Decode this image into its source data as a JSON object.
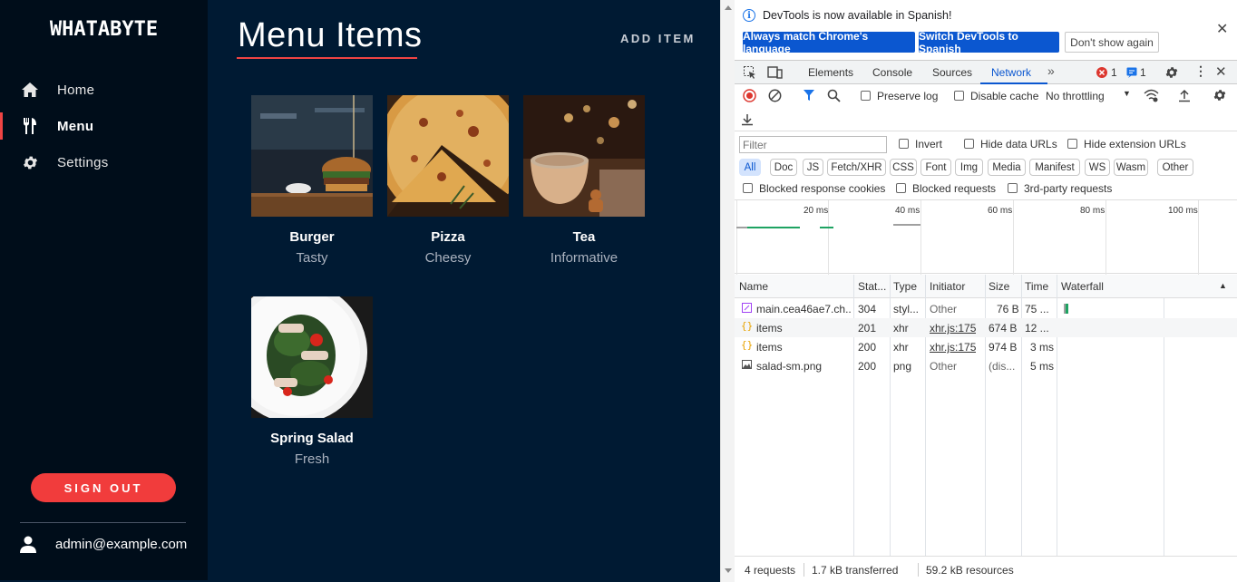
{
  "app": {
    "brand": "WHATABYTE",
    "nav": [
      {
        "label": "Home",
        "icon": "home-icon"
      },
      {
        "label": "Menu",
        "icon": "utensils-icon"
      },
      {
        "label": "Settings",
        "icon": "gear-icon"
      }
    ],
    "active_nav": "Menu",
    "sign_out": "SIGN OUT",
    "user_email": "admin@example.com",
    "page_title": "Menu Items",
    "add_item": "ADD ITEM",
    "items": [
      {
        "name": "Burger",
        "description": "Tasty"
      },
      {
        "name": "Pizza",
        "description": "Cheesy"
      },
      {
        "name": "Tea",
        "description": "Informative"
      },
      {
        "name": "Spring Salad",
        "description": "Fresh"
      }
    ],
    "colors": {
      "background": "#001a33",
      "sidebar": "#000d1a",
      "accent": "#f13c3c"
    }
  },
  "devtools": {
    "infobar": {
      "message": "DevTools is now available in Spanish!",
      "btn_match": "Always match Chrome's language",
      "btn_switch": "Switch DevTools to Spanish",
      "btn_dismiss": "Don't show again"
    },
    "tabs": [
      "Elements",
      "Console",
      "Sources",
      "Network"
    ],
    "active_tab": "Network",
    "error_count": "1",
    "message_count": "1",
    "toolbar": {
      "preserve_log": "Preserve log",
      "disable_cache": "Disable cache",
      "throttling": "No throttling"
    },
    "filter": {
      "placeholder": "Filter",
      "invert": "Invert",
      "hide_data_urls": "Hide data URLs",
      "hide_extension_urls": "Hide extension URLs"
    },
    "type_filters": [
      "All",
      "Doc",
      "JS",
      "Fetch/XHR",
      "CSS",
      "Font",
      "Img",
      "Media",
      "Manifest",
      "WS",
      "Wasm",
      "Other"
    ],
    "active_type": "All",
    "block_filters": {
      "blocked_cookies": "Blocked response cookies",
      "blocked_requests": "Blocked requests",
      "third_party": "3rd-party requests"
    },
    "overview_ticks": [
      "20 ms",
      "40 ms",
      "60 ms",
      "80 ms",
      "100 ms"
    ],
    "columns": [
      "Name",
      "Stat...",
      "Type",
      "Initiator",
      "Size",
      "Time",
      "Waterfall"
    ],
    "requests": [
      {
        "name": "main.cea46ae7.ch...",
        "status": "304",
        "type": "styl...",
        "initiator": "Other",
        "size": "76 B",
        "time": "75 ...",
        "icon": "stylesheet-icon"
      },
      {
        "name": "items",
        "status": "201",
        "type": "xhr",
        "initiator": "xhr.js:175",
        "size": "674 B",
        "time": "12 ...",
        "icon": "xhr-icon"
      },
      {
        "name": "items",
        "status": "200",
        "type": "xhr",
        "initiator": "xhr.js:175",
        "size": "974 B",
        "time": "3 ms",
        "icon": "xhr-icon"
      },
      {
        "name": "salad-sm.png",
        "status": "200",
        "type": "png",
        "initiator": "Other",
        "size": "(dis...",
        "time": "5 ms",
        "icon": "image-icon"
      }
    ],
    "status_bar": {
      "requests": "4 requests",
      "transferred": "1.7 kB transferred",
      "resources": "59.2 kB resources"
    }
  }
}
